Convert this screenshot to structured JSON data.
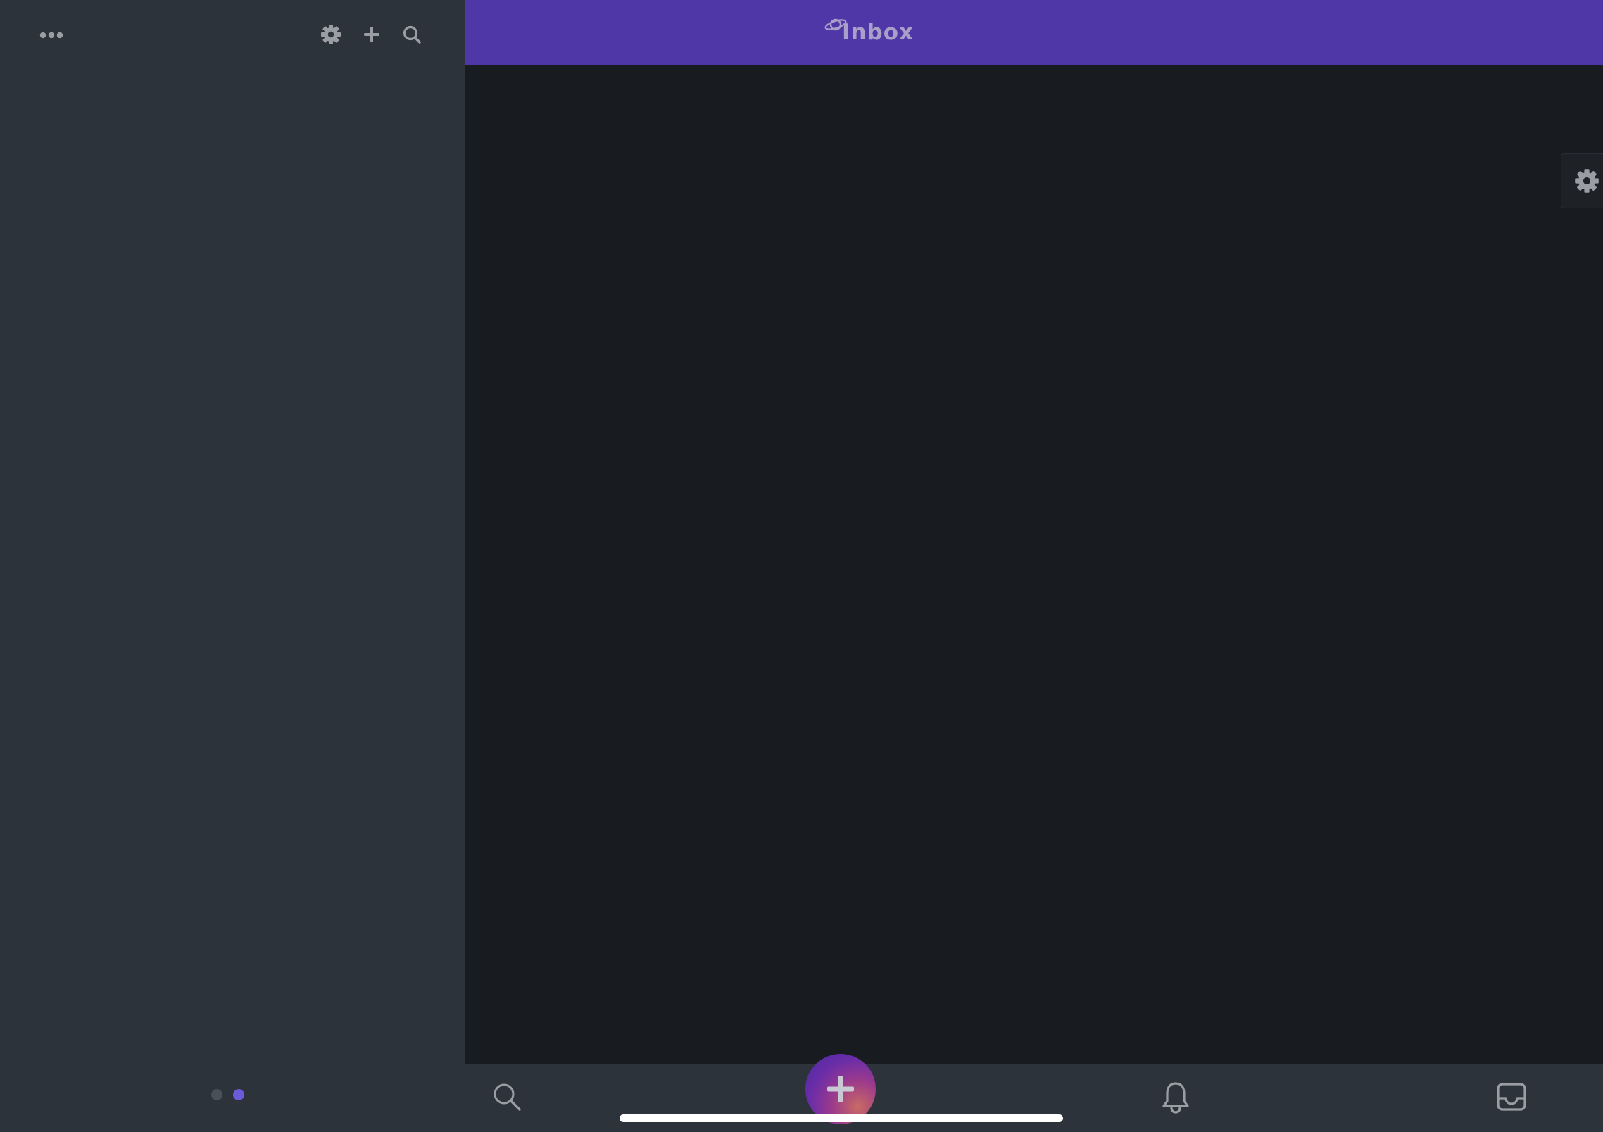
{
  "header": {
    "title": "Inbox"
  },
  "sidebar": {
    "toolbar": {
      "icons": [
        "more-icon",
        "gear-icon",
        "plus-icon",
        "search-icon"
      ]
    },
    "pagination": {
      "pages": 2,
      "active_page": 2
    }
  },
  "bottom_nav": {
    "items": [
      "search-icon",
      "compose-button",
      "bell-icon",
      "inbox-icon"
    ]
  },
  "colors": {
    "header_bg": "#4f37a8",
    "sidebar_bg": "#2d333a",
    "main_bg": "#181b20",
    "active_dot": "#6b5bd8",
    "icon_gray": "#9a9ea4"
  }
}
